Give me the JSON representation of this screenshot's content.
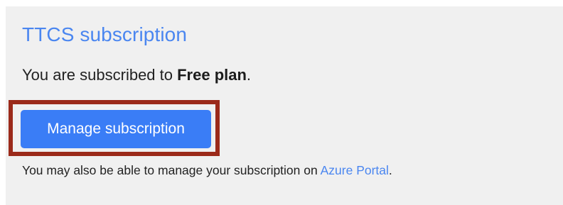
{
  "subscription": {
    "title": "TTCS subscription",
    "status_prefix": "You are subscribed to ",
    "plan_name": "Free plan",
    "status_suffix": ".",
    "manage_button_label": "Manage subscription",
    "note_prefix": "You may also be able to manage your subscription on ",
    "portal_link_label": "Azure Portal",
    "note_suffix": "."
  },
  "colors": {
    "link": "#4a86f0",
    "button": "#3a7df6",
    "highlight_border": "#9b2a1a",
    "panel_background": "#f0f0f0"
  }
}
